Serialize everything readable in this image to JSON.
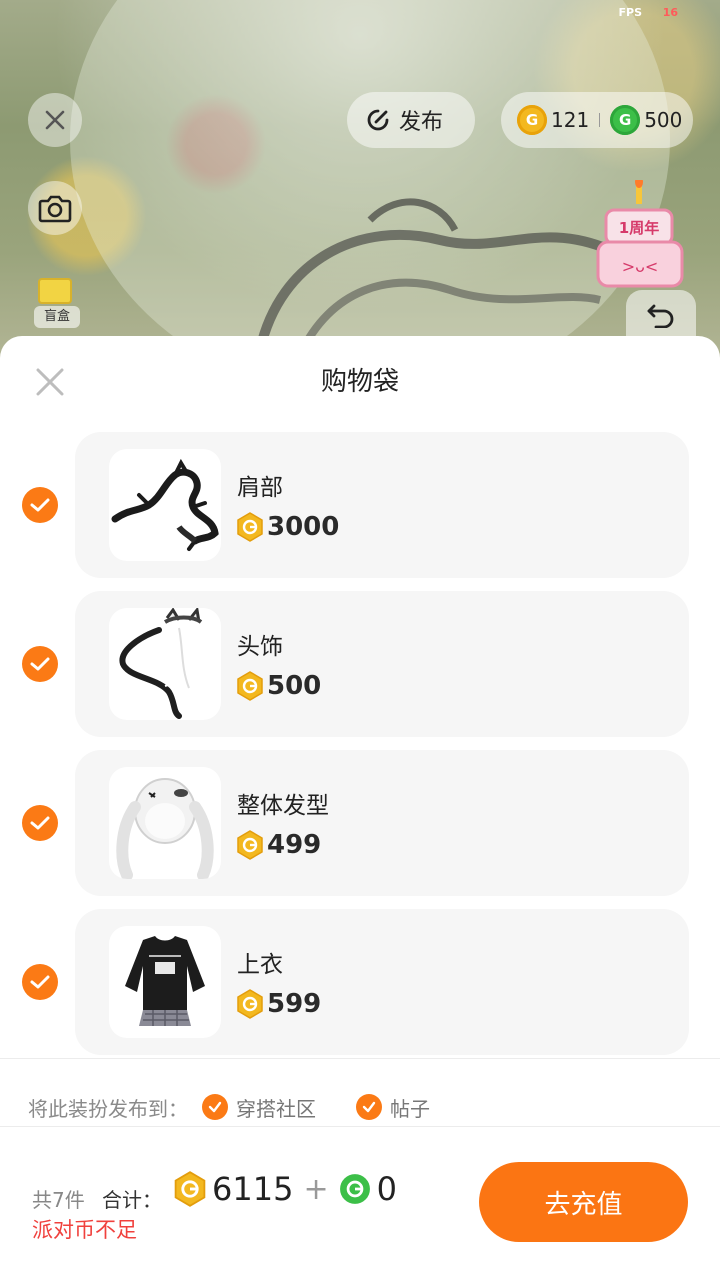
{
  "status": {
    "fps_label": "FPS",
    "fps_value": "16"
  },
  "top_bar": {
    "publish_label": "发布",
    "gold_balance": "121",
    "green_balance": "500"
  },
  "left_tools": {
    "blindbox_label": "盲盒"
  },
  "sheet": {
    "title": "购物袋",
    "items": [
      {
        "name": "肩部",
        "price": "3000",
        "checked": true,
        "thumb": "black-dragon-icon"
      },
      {
        "name": "头饰",
        "price": "500",
        "checked": true,
        "thumb": "cat-ear-tail-icon"
      },
      {
        "name": "整体发型",
        "price": "499",
        "checked": true,
        "thumb": "white-twintail-hair-icon"
      },
      {
        "name": "上衣",
        "price": "599",
        "checked": true,
        "thumb": "black-sweater-outfit-icon"
      }
    ],
    "publish_to": {
      "label": "将此装扮发布到：",
      "options": [
        {
          "label": "穿搭社区",
          "checked": true
        },
        {
          "label": "帖子",
          "checked": true
        }
      ]
    },
    "footer": {
      "count_text": "共7件",
      "total_label": "合计：",
      "gold_total": "6115",
      "plus": "+",
      "green_total": "0",
      "warning": "派对币不足",
      "recharge_label": "去充值"
    }
  },
  "colors": {
    "accent": "#fb7513",
    "warning": "#f0413d",
    "gold": "#f3b81f",
    "green": "#3cbf48"
  }
}
